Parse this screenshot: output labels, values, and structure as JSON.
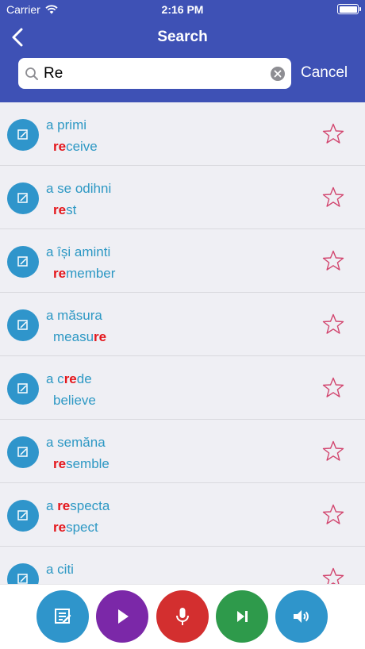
{
  "status": {
    "carrier": "Carrier",
    "time": "2:16 PM"
  },
  "nav": {
    "title": "Search",
    "back_icon": "chevron-left-icon"
  },
  "search": {
    "value": "Re",
    "cancel_label": "Cancel"
  },
  "results": [
    {
      "word": [
        "a primi"
      ],
      "translation": [
        "",
        "re",
        "ceive"
      ],
      "starred": false
    },
    {
      "word": [
        "a se odihni"
      ],
      "translation": [
        "",
        "re",
        "st"
      ],
      "starred": false
    },
    {
      "word": [
        "a își aminti"
      ],
      "translation": [
        "",
        "re",
        "member"
      ],
      "starred": false
    },
    {
      "word": [
        "a măsura"
      ],
      "translation": [
        "measu",
        "re",
        ""
      ],
      "starred": false
    },
    {
      "word": [
        "a c",
        "re",
        "de"
      ],
      "translation": [
        "believe"
      ],
      "starred": false
    },
    {
      "word": [
        "a semăna"
      ],
      "translation": [
        "",
        "re",
        "semble"
      ],
      "starred": false
    },
    {
      "word": [
        "a ",
        "re",
        "specta"
      ],
      "translation": [
        "",
        "re",
        "spect"
      ],
      "starred": false
    },
    {
      "word": [
        "a citi"
      ],
      "translation": [
        ""
      ],
      "starred": false
    }
  ],
  "toolbar": [
    {
      "icon": "edit-note-icon",
      "color": "#2f95cb"
    },
    {
      "icon": "play-icon",
      "color": "#7b28a8"
    },
    {
      "icon": "microphone-icon",
      "color": "#d32f2f"
    },
    {
      "icon": "skip-next-icon",
      "color": "#2e9a4b"
    },
    {
      "icon": "speaker-icon",
      "color": "#2f95cb"
    }
  ],
  "colors": {
    "header": "#3e51b5",
    "text_accent": "#2d98c4",
    "highlight": "#e4161b",
    "star": "#d2456e"
  }
}
